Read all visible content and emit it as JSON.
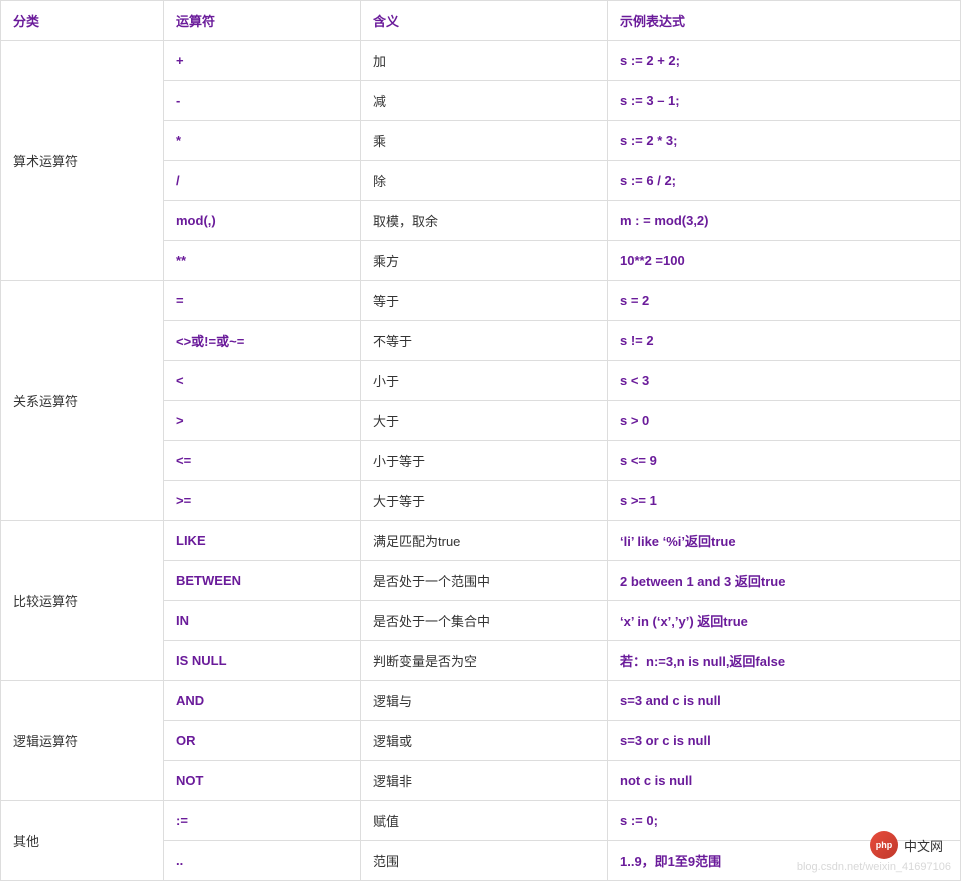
{
  "headers": {
    "category": "分类",
    "operator": "运算符",
    "meaning": "含义",
    "example": "示例表达式"
  },
  "groups": [
    {
      "category": "算术运算符",
      "rows": [
        {
          "op": "+",
          "meaning": "加",
          "example": "s := 2 + 2;"
        },
        {
          "op": "-",
          "meaning": "减",
          "example": "s := 3 – 1;"
        },
        {
          "op": "*",
          "meaning": "乘",
          "example": "s := 2 * 3;"
        },
        {
          "op": "/",
          "meaning": "除",
          "example": "s := 6 / 2;"
        },
        {
          "op": "mod(,)",
          "meaning": "取模，取余",
          "example": "m : = mod(3,2)"
        },
        {
          "op": "**",
          "meaning": "乘方",
          "example": "10**2 =100"
        }
      ]
    },
    {
      "category": "关系运算符",
      "rows": [
        {
          "op": "=",
          "meaning": "等于",
          "example": "s = 2"
        },
        {
          "op": "<>或!=或~=",
          "meaning": "不等于",
          "example": "s != 2"
        },
        {
          "op": "<",
          "meaning": "小于",
          "example": "s < 3"
        },
        {
          "op": ">",
          "meaning": "大于",
          "example": "s > 0"
        },
        {
          "op": "<=",
          "meaning": "小于等于",
          "example": "s <= 9"
        },
        {
          "op": ">=",
          "meaning": "大于等于",
          "example": "s >= 1"
        }
      ]
    },
    {
      "category": "比较运算符",
      "rows": [
        {
          "op": "LIKE",
          "meaning": "满足匹配为true",
          "example": "‘li’ like ‘%i’返回true"
        },
        {
          "op": "BETWEEN",
          "meaning": "是否处于一个范围中",
          "example": "2 between 1 and 3 返回true"
        },
        {
          "op": "IN",
          "meaning": "是否处于一个集合中",
          "example": "‘x’ in (‘x’,’y’) 返回true"
        },
        {
          "op": "IS NULL",
          "meaning": "判断变量是否为空",
          "example": "若：n:=3,n is null,返回false"
        }
      ]
    },
    {
      "category": "逻辑运算符",
      "rows": [
        {
          "op": "AND",
          "meaning": "逻辑与",
          "example": "s=3 and c is null"
        },
        {
          "op": "OR",
          "meaning": "逻辑或",
          "example": "s=3 or c is null"
        },
        {
          "op": "NOT",
          "meaning": "逻辑非",
          "example": "not c is null"
        }
      ]
    },
    {
      "category": "其他",
      "rows": [
        {
          "op": ":=",
          "meaning": "赋值",
          "example": "s := 0;"
        },
        {
          "op": "..",
          "meaning": "范围",
          "example": "1..9，即1至9范围"
        }
      ]
    }
  ],
  "badge": {
    "logo_text": "php",
    "label": "中文网"
  },
  "watermark": "blog.csdn.net/weixin_41697106"
}
